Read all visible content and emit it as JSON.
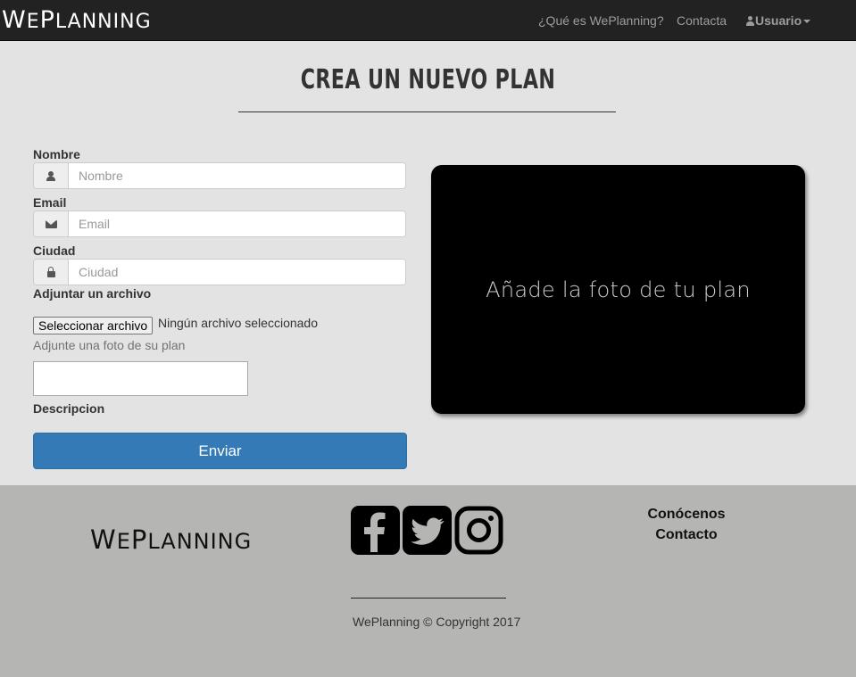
{
  "navbar": {
    "brand_big1": "W",
    "brand_small1": "E",
    "brand_big2": "P",
    "brand_small2": "LANNING",
    "links": [
      {
        "label": "¿Qué es WePlanning?"
      },
      {
        "label": "Contacta"
      }
    ],
    "user_label": "Usuario"
  },
  "main": {
    "title": "CREA UN NUEVO PLAN",
    "form": {
      "nombre_label": "Nombre",
      "nombre_placeholder": "Nombre",
      "email_label": "Email",
      "email_placeholder": "Email",
      "ciudad_label": "Ciudad",
      "ciudad_placeholder": "Ciudad",
      "file_label": "Adjuntar un archivo",
      "file_button": "Seleccionar archivo",
      "file_status": "Ningún archivo seleccionado",
      "file_help": "Adjunte una foto de su plan",
      "descripcion_label": "Descripcion",
      "submit_label": "Enviar"
    },
    "photo_placeholder": "Añade la foto de tu plan"
  },
  "footer": {
    "brand_big1": "W",
    "brand_small1": "E",
    "brand_big2": "P",
    "brand_small2": "LANNING",
    "social": [
      "facebook-icon",
      "twitter-icon",
      "instagram-icon"
    ],
    "links": [
      {
        "label": "Conócenos"
      },
      {
        "label": "Contacto"
      }
    ],
    "copyright": "WePlanning © Copyright 2017"
  },
  "colors": {
    "navbar_bg": "#222222",
    "primary": "#337ab7",
    "footer_bg": "#b5b5b4"
  }
}
